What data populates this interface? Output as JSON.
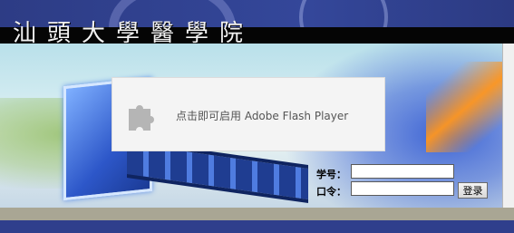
{
  "header": {
    "school_name": "汕頭大學醫學院"
  },
  "flash_placeholder": {
    "message": "点击即可启用 Adobe Flash Player",
    "icon": "puzzle-piece-icon"
  },
  "login": {
    "student_id_label": "学号：",
    "student_id_value": "",
    "password_label": "口令：",
    "password_value": "",
    "submit_label": "登录"
  },
  "colors": {
    "header_background": "#2f3f8c",
    "title_strip": "#050505",
    "bottom_strip": "#a9a694",
    "placeholder_background": "#f4f4f4"
  }
}
